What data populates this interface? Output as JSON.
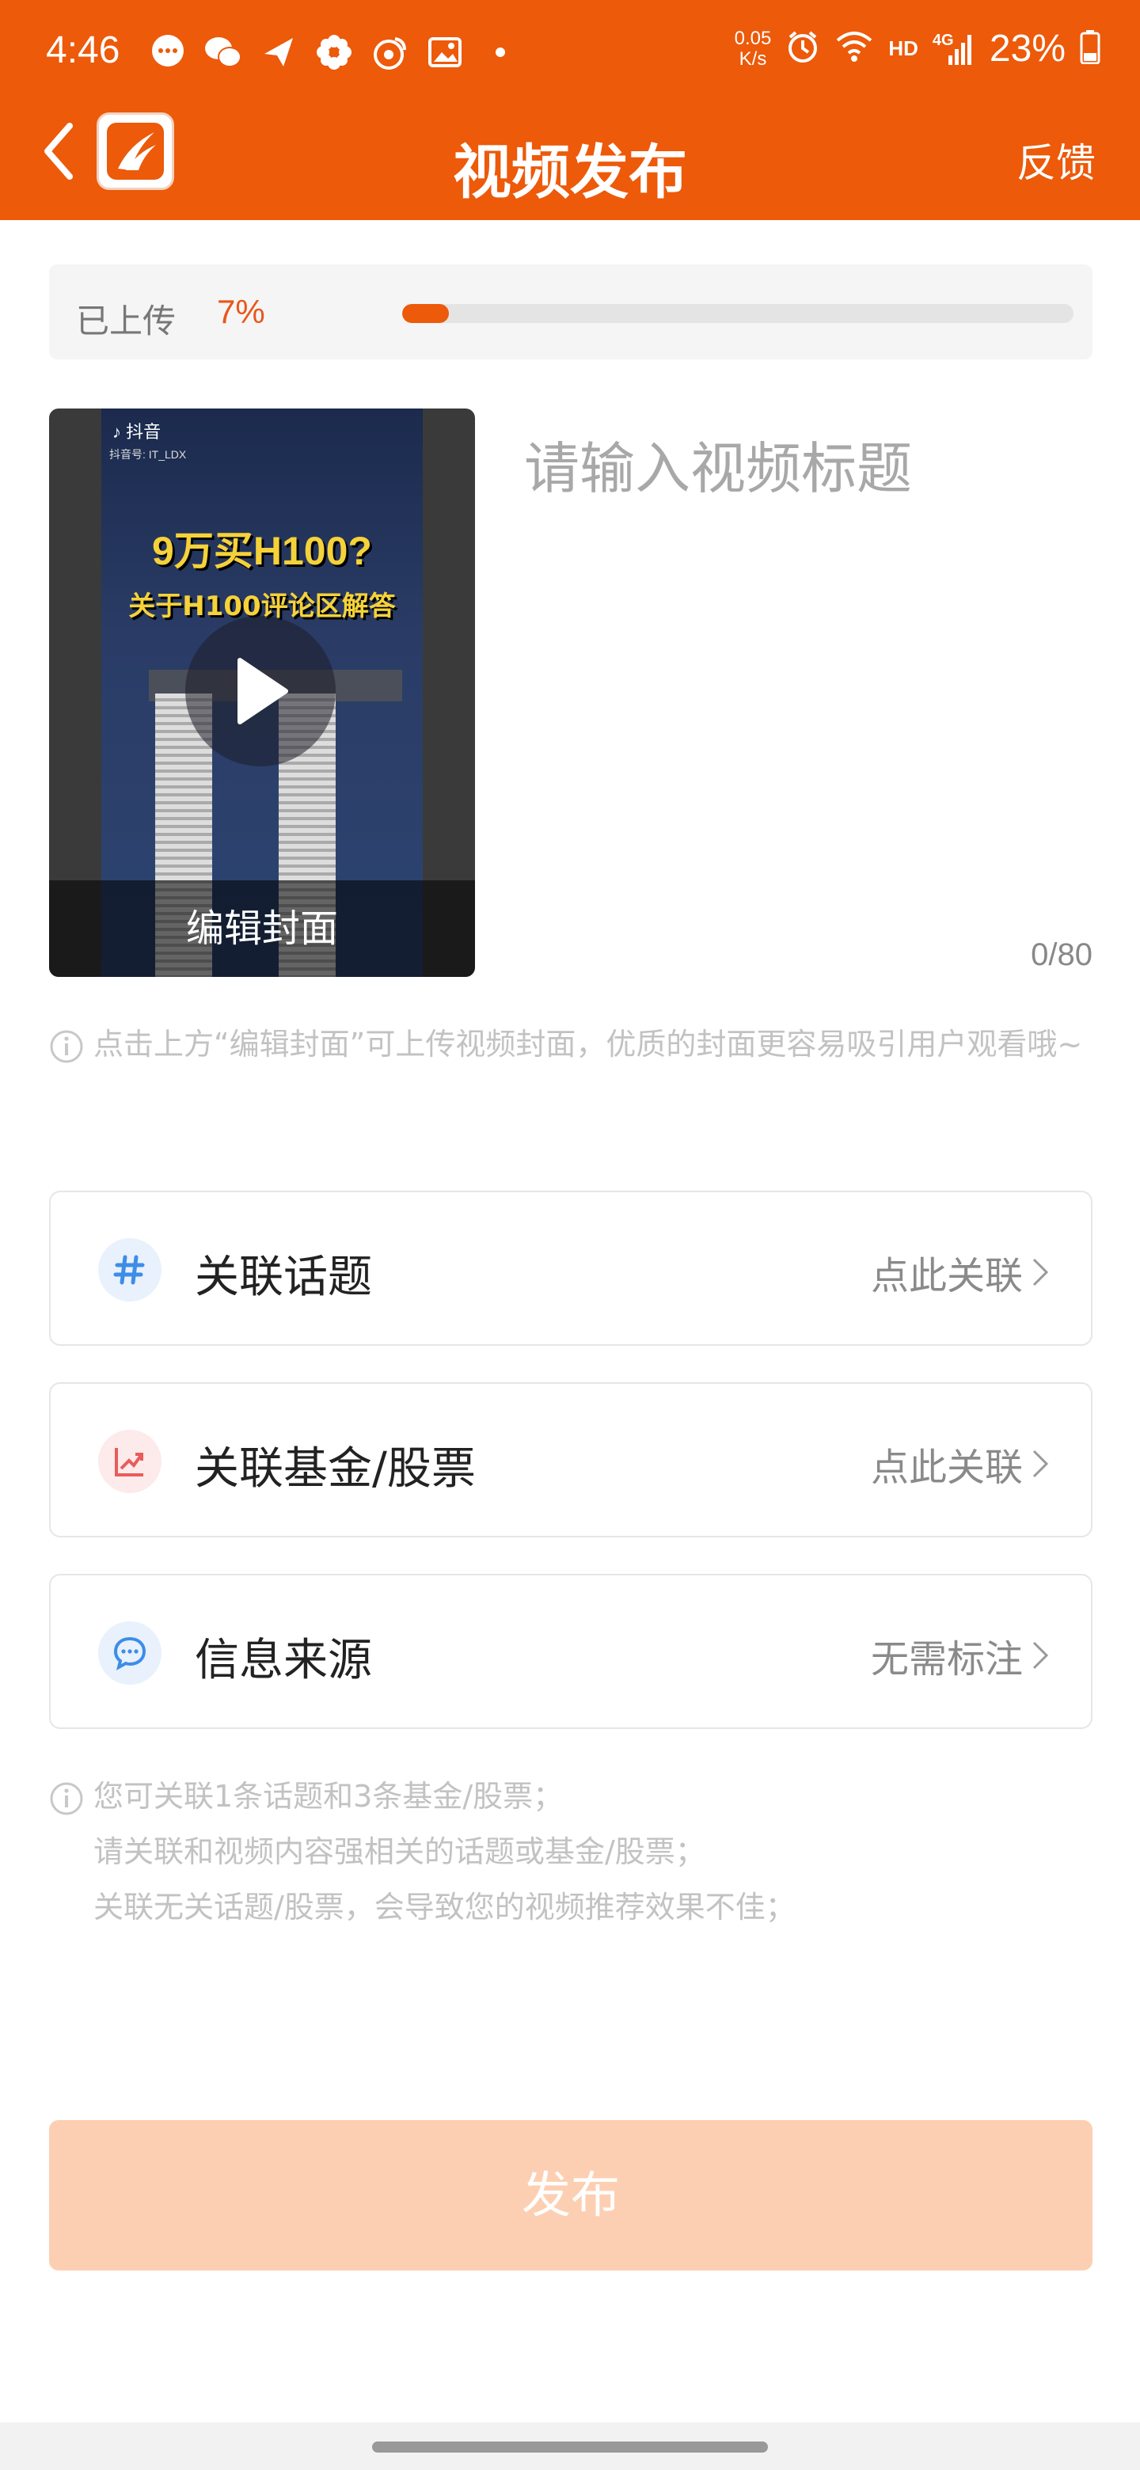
{
  "status_bar": {
    "time": "4:46",
    "speed_value": "0.05",
    "speed_unit": "K/s",
    "network_hd": "HD",
    "network_4g": "4G",
    "battery": "23%"
  },
  "app_bar": {
    "title": "视频发布",
    "feedback": "反馈"
  },
  "upload": {
    "label": "已上传",
    "percent_text": "7%",
    "progress_fraction": 0.07
  },
  "cover": {
    "tiktok_label": "抖音",
    "tiktok_id": "抖音号: IT_LDX",
    "headline": "9万买H100?",
    "subline": "关于H100评论区解答",
    "edit_label": "编辑封面"
  },
  "title_field": {
    "placeholder": "请输入视频标题",
    "count": "0/80"
  },
  "tip_cover": "点击上方“编辑封面”可上传视频封面，优质的封面更容易吸引用户观看哦~",
  "rows": [
    {
      "label": "关联话题",
      "action": "点此关联"
    },
    {
      "label": "关联基金/股票",
      "action": "点此关联"
    },
    {
      "label": "信息来源",
      "action": "无需标注"
    }
  ],
  "tips_link": [
    "您可关联1条话题和3条基金/股票；",
    "请关联和视频内容强相关的话题或基金/股票；",
    "关联无关话题/股票，会导致您的视频推荐效果不佳；"
  ],
  "publish": "发布",
  "colors": {
    "brand": "#ec5a0a",
    "publish_disabled": "#fdcfb2"
  }
}
